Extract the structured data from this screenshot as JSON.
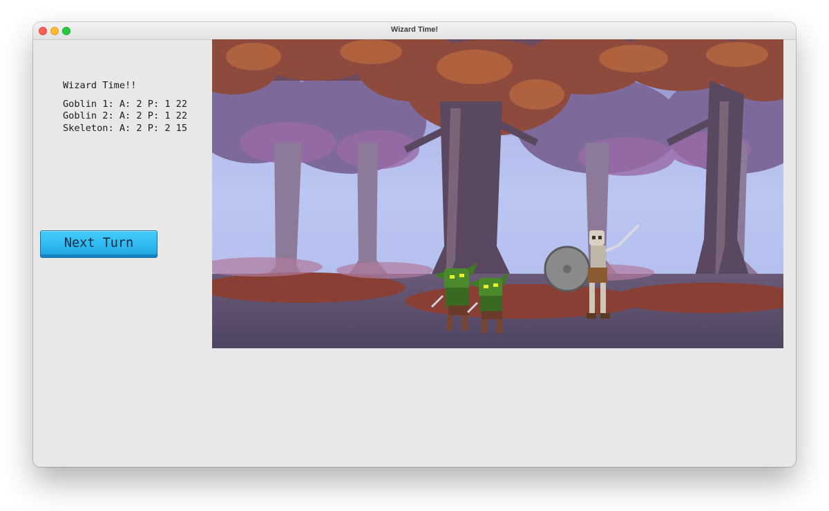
{
  "window": {
    "title": "Wizard Time!"
  },
  "panel": {
    "heading": "Wizard Time!!",
    "stats": [
      "Goblin 1: A: 2 P: 1 22",
      "Goblin 2: A: 2 P: 1 22",
      "Skeleton: A: 2 P: 2 15"
    ]
  },
  "controls": {
    "next_turn_label": "Next Turn"
  },
  "scene": {
    "characters": [
      {
        "name": "goblin-1",
        "icon": "goblin-sprite"
      },
      {
        "name": "goblin-2",
        "icon": "goblin-sprite"
      },
      {
        "name": "skeleton",
        "icon": "skeleton-sprite"
      }
    ]
  },
  "colors": {
    "window_bg": "#e8e8e8",
    "button": "#2cb8f0",
    "sky": "#a9b4ec",
    "trunk": "#5a4760",
    "foliage": "#8e4a3c",
    "goblin": "#4a8a2a",
    "ground": "#564a62"
  }
}
